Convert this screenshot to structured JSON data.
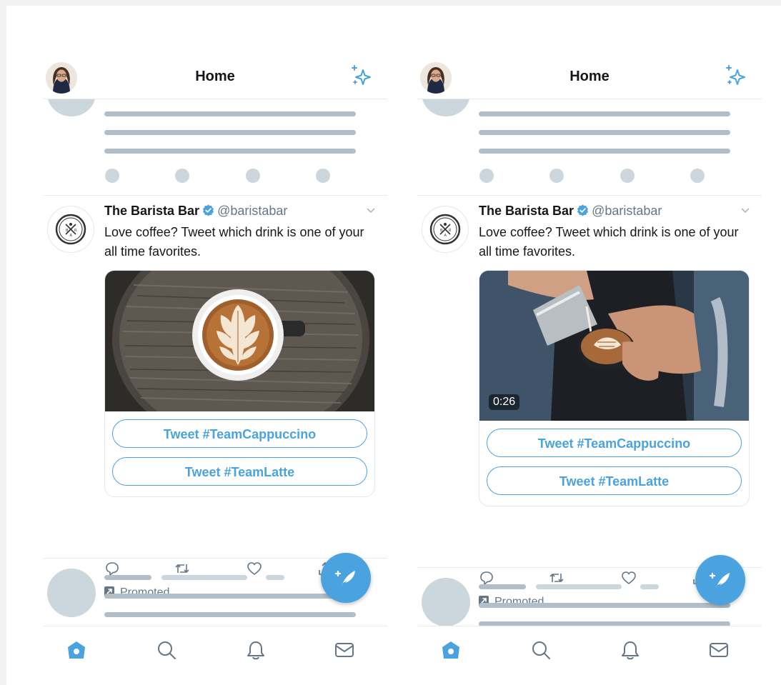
{
  "colors": {
    "accent": "#4aa3df",
    "text": "#14171a",
    "muted": "#657786",
    "skeleton": "#ccd6dd"
  },
  "phones": [
    {
      "header": {
        "title": "Home"
      },
      "tweet": {
        "name": "The Barista Bar",
        "handle": "@baristabar",
        "text": "Love coffee? Tweet which drink is one of your all time favorites.",
        "buttons": [
          "Tweet #TeamCappuccino",
          "Tweet #TeamLatte"
        ],
        "promoted": "Promoted"
      }
    },
    {
      "header": {
        "title": "Home"
      },
      "tweet": {
        "name": "The Barista Bar",
        "handle": "@baristabar",
        "text": "Love coffee? Tweet which drink is one of your all time favorites.",
        "video_duration": "0:26",
        "buttons": [
          "Tweet #TeamCappuccino",
          "Tweet #TeamLatte"
        ],
        "promoted": "Promoted"
      }
    }
  ],
  "icons": {
    "header_left": "profile-avatar",
    "header_right": "sparkle-icon",
    "actions": [
      "reply-icon",
      "retweet-icon",
      "like-icon",
      "share-icon"
    ],
    "tabs": [
      "home-icon",
      "search-icon",
      "notifications-icon",
      "messages-icon"
    ],
    "fab": "compose-tweet-icon"
  }
}
